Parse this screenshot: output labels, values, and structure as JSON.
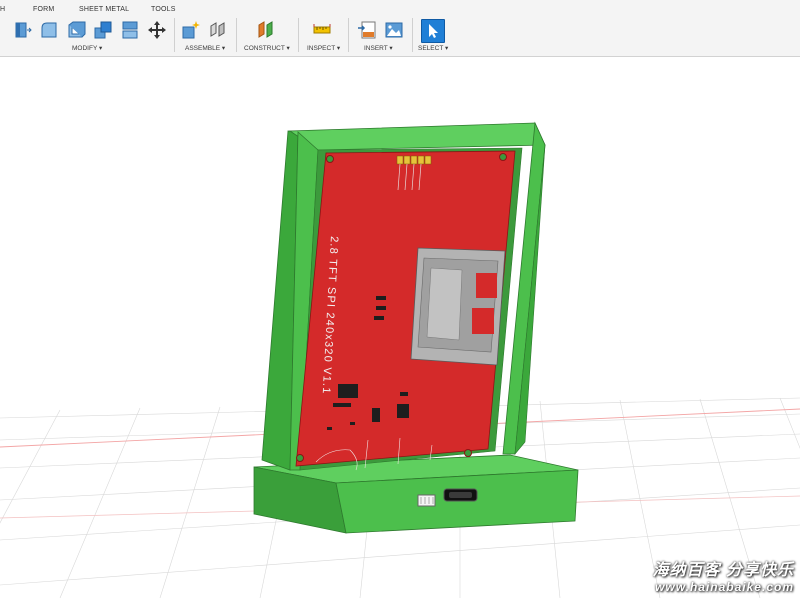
{
  "toolbar": {
    "tabs": [
      "H",
      "FORM",
      "SHEET METAL",
      "TOOLS"
    ],
    "groups": {
      "modify": "MODIFY ▾",
      "assemble": "ASSEMBLE ▾",
      "construct": "CONSTRUCT ▾",
      "inspect": "INSPECT ▾",
      "insert": "INSERT ▾",
      "select": "SELECT ▾"
    },
    "icons": {
      "modify": [
        "press-pull-icon",
        "fillet-icon",
        "shell-icon",
        "combine-icon",
        "split-icon",
        "move-icon"
      ],
      "assemble": [
        "new-component-icon",
        "joint-icon"
      ],
      "construct": [
        "offset-plane-icon"
      ],
      "inspect": [
        "measure-icon"
      ],
      "insert": [
        "insert-svg-icon",
        "insert-image-icon"
      ],
      "select": [
        "select-arrow-icon"
      ]
    }
  },
  "model": {
    "silkscreen_title": "2.8 TFT SPI 240x320 V1.1",
    "case_color": "#4cbf4c",
    "pcb_color": "#d42a2a"
  },
  "watermark": {
    "chinese": "海纳百客 分享快乐",
    "url": "www.hainabaike.com"
  }
}
